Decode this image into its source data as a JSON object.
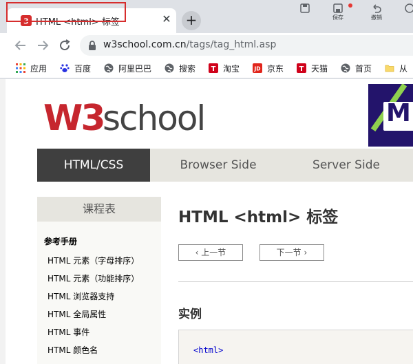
{
  "tabs": [
    {
      "title": "HTML <html> 标签",
      "close_glyph": "✕"
    }
  ],
  "new_tab_glyph": "+",
  "extensions": [
    {
      "label": "保存"
    },
    {
      "label": "撤销"
    }
  ],
  "toolbar": {
    "url_host": "w3school.com.cn",
    "url_path": "/tags/tag_html.asp"
  },
  "bookmarks": [
    {
      "label": "应用",
      "icon": "apps-grid-icon"
    },
    {
      "label": "百度",
      "icon": "baidu-paw-icon"
    },
    {
      "label": "阿里巴巴",
      "icon": "globe-icon"
    },
    {
      "label": "搜索",
      "icon": "globe-icon"
    },
    {
      "label": "淘宝",
      "icon": "taobao-icon"
    },
    {
      "label": "京东",
      "icon": "jd-icon"
    },
    {
      "label": "天猫",
      "icon": "tmall-icon"
    },
    {
      "label": "首页",
      "icon": "globe-icon"
    },
    {
      "label": "从",
      "icon": "folder-icon"
    }
  ],
  "banner": {
    "letter": "M"
  },
  "topnav": [
    {
      "label": "HTML/CSS",
      "active": true
    },
    {
      "label": "Browser Side",
      "active": false
    },
    {
      "label": "Server Side",
      "active": false
    }
  ],
  "sidebar": {
    "title": "课程表",
    "subtitle": "参考手册",
    "links": [
      "HTML 元素（字母排序）",
      "HTML 元素（功能排序）",
      "HTML 浏览器支持",
      "HTML 全局属性",
      "HTML 事件",
      "HTML 颜色名"
    ]
  },
  "main": {
    "title": "HTML <html> 标签",
    "prev_label": "上一节",
    "next_label": "下一节",
    "section_title": "实例",
    "code_line": "<html>"
  },
  "colors": {
    "accent_red": "#d62d2d",
    "nav_active": "#3f3f3f",
    "nav_bg": "#e6e5df"
  }
}
